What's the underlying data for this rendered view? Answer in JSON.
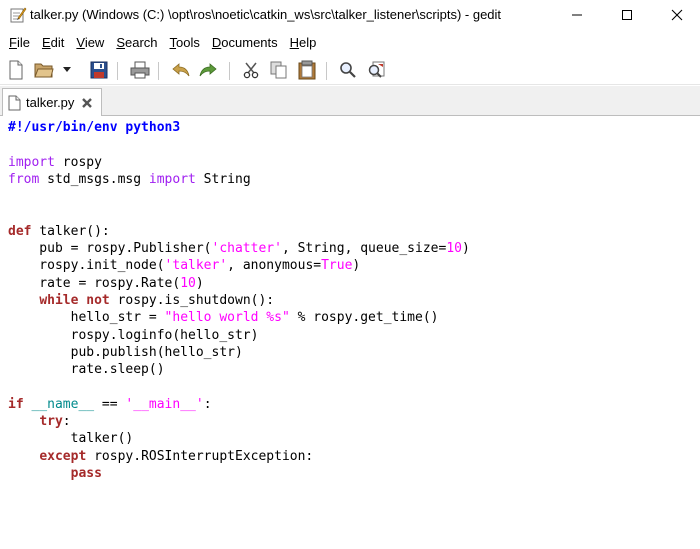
{
  "window": {
    "title": "talker.py (Windows (C:) \\opt\\ros\\noetic\\catkin_ws\\src\\talker_listener\\scripts) - gedit",
    "controls": {
      "minimize": "minimize-icon",
      "maximize": "maximize-icon",
      "close": "close-icon"
    }
  },
  "menu": {
    "file": "File",
    "edit": "Edit",
    "view": "View",
    "search": "Search",
    "tools": "Tools",
    "documents": "Documents",
    "help": "Help"
  },
  "toolbar": {
    "icons": [
      "new-document-icon",
      "open-folder-icon",
      "dropdown-arrow-icon",
      "save-icon",
      "print-icon",
      "undo-icon",
      "redo-icon",
      "cut-icon",
      "copy-icon",
      "paste-icon",
      "find-icon",
      "find-replace-icon"
    ]
  },
  "tabs": [
    {
      "label": "talker.py",
      "icon": "document-icon",
      "close": "close-tab-icon"
    }
  ],
  "colors": {
    "keyword": "#a52a2a",
    "import": "#a020f0",
    "string": "#ff00ff",
    "shebang": "#0000ff",
    "dunder": "#008a8c"
  },
  "code": {
    "lines": [
      [
        {
          "t": "#!/usr/bin/env python3",
          "c": "shebang"
        }
      ],
      [],
      [
        {
          "t": "import",
          "c": "imp"
        },
        {
          "t": " rospy",
          "c": "plain"
        }
      ],
      [
        {
          "t": "from",
          "c": "imp"
        },
        {
          "t": " std_msgs.msg ",
          "c": "plain"
        },
        {
          "t": "import",
          "c": "imp"
        },
        {
          "t": " String",
          "c": "plain"
        }
      ],
      [],
      [],
      [
        {
          "t": "def",
          "c": "kw"
        },
        {
          "t": " talker():",
          "c": "plain"
        }
      ],
      [
        {
          "t": "    pub = rospy.Publisher(",
          "c": "plain"
        },
        {
          "t": "'chatter'",
          "c": "str"
        },
        {
          "t": ", String, queue_size=",
          "c": "plain"
        },
        {
          "t": "10",
          "c": "num"
        },
        {
          "t": ")",
          "c": "plain"
        }
      ],
      [
        {
          "t": "    rospy.init_node(",
          "c": "plain"
        },
        {
          "t": "'talker'",
          "c": "str"
        },
        {
          "t": ", anonymous=",
          "c": "plain"
        },
        {
          "t": "True",
          "c": "const"
        },
        {
          "t": ")",
          "c": "plain"
        }
      ],
      [
        {
          "t": "    rate = rospy.Rate(",
          "c": "plain"
        },
        {
          "t": "10",
          "c": "num"
        },
        {
          "t": ")",
          "c": "plain"
        }
      ],
      [
        {
          "t": "    ",
          "c": "plain"
        },
        {
          "t": "while",
          "c": "kw"
        },
        {
          "t": " ",
          "c": "plain"
        },
        {
          "t": "not",
          "c": "kw"
        },
        {
          "t": " rospy.is_shutdown():",
          "c": "plain"
        }
      ],
      [
        {
          "t": "        hello_str = ",
          "c": "plain"
        },
        {
          "t": "\"hello world %s\"",
          "c": "str"
        },
        {
          "t": " % rospy.get_time()",
          "c": "plain"
        }
      ],
      [
        {
          "t": "        rospy.loginfo(hello_str)",
          "c": "plain"
        }
      ],
      [
        {
          "t": "        pub.publish(hello_str)",
          "c": "plain"
        }
      ],
      [
        {
          "t": "        rate.sleep()",
          "c": "plain"
        }
      ],
      [],
      [
        {
          "t": "if",
          "c": "kw"
        },
        {
          "t": " ",
          "c": "plain"
        },
        {
          "t": "__name__",
          "c": "dunder"
        },
        {
          "t": " == ",
          "c": "plain"
        },
        {
          "t": "'__main__'",
          "c": "str"
        },
        {
          "t": ":",
          "c": "plain"
        }
      ],
      [
        {
          "t": "    ",
          "c": "plain"
        },
        {
          "t": "try",
          "c": "kw"
        },
        {
          "t": ":",
          "c": "plain"
        }
      ],
      [
        {
          "t": "        talker()",
          "c": "plain"
        }
      ],
      [
        {
          "t": "    ",
          "c": "plain"
        },
        {
          "t": "except",
          "c": "kw"
        },
        {
          "t": " rospy.ROSInterruptException:",
          "c": "plain"
        }
      ],
      [
        {
          "t": "        ",
          "c": "plain"
        },
        {
          "t": "pass",
          "c": "kw"
        }
      ]
    ]
  }
}
